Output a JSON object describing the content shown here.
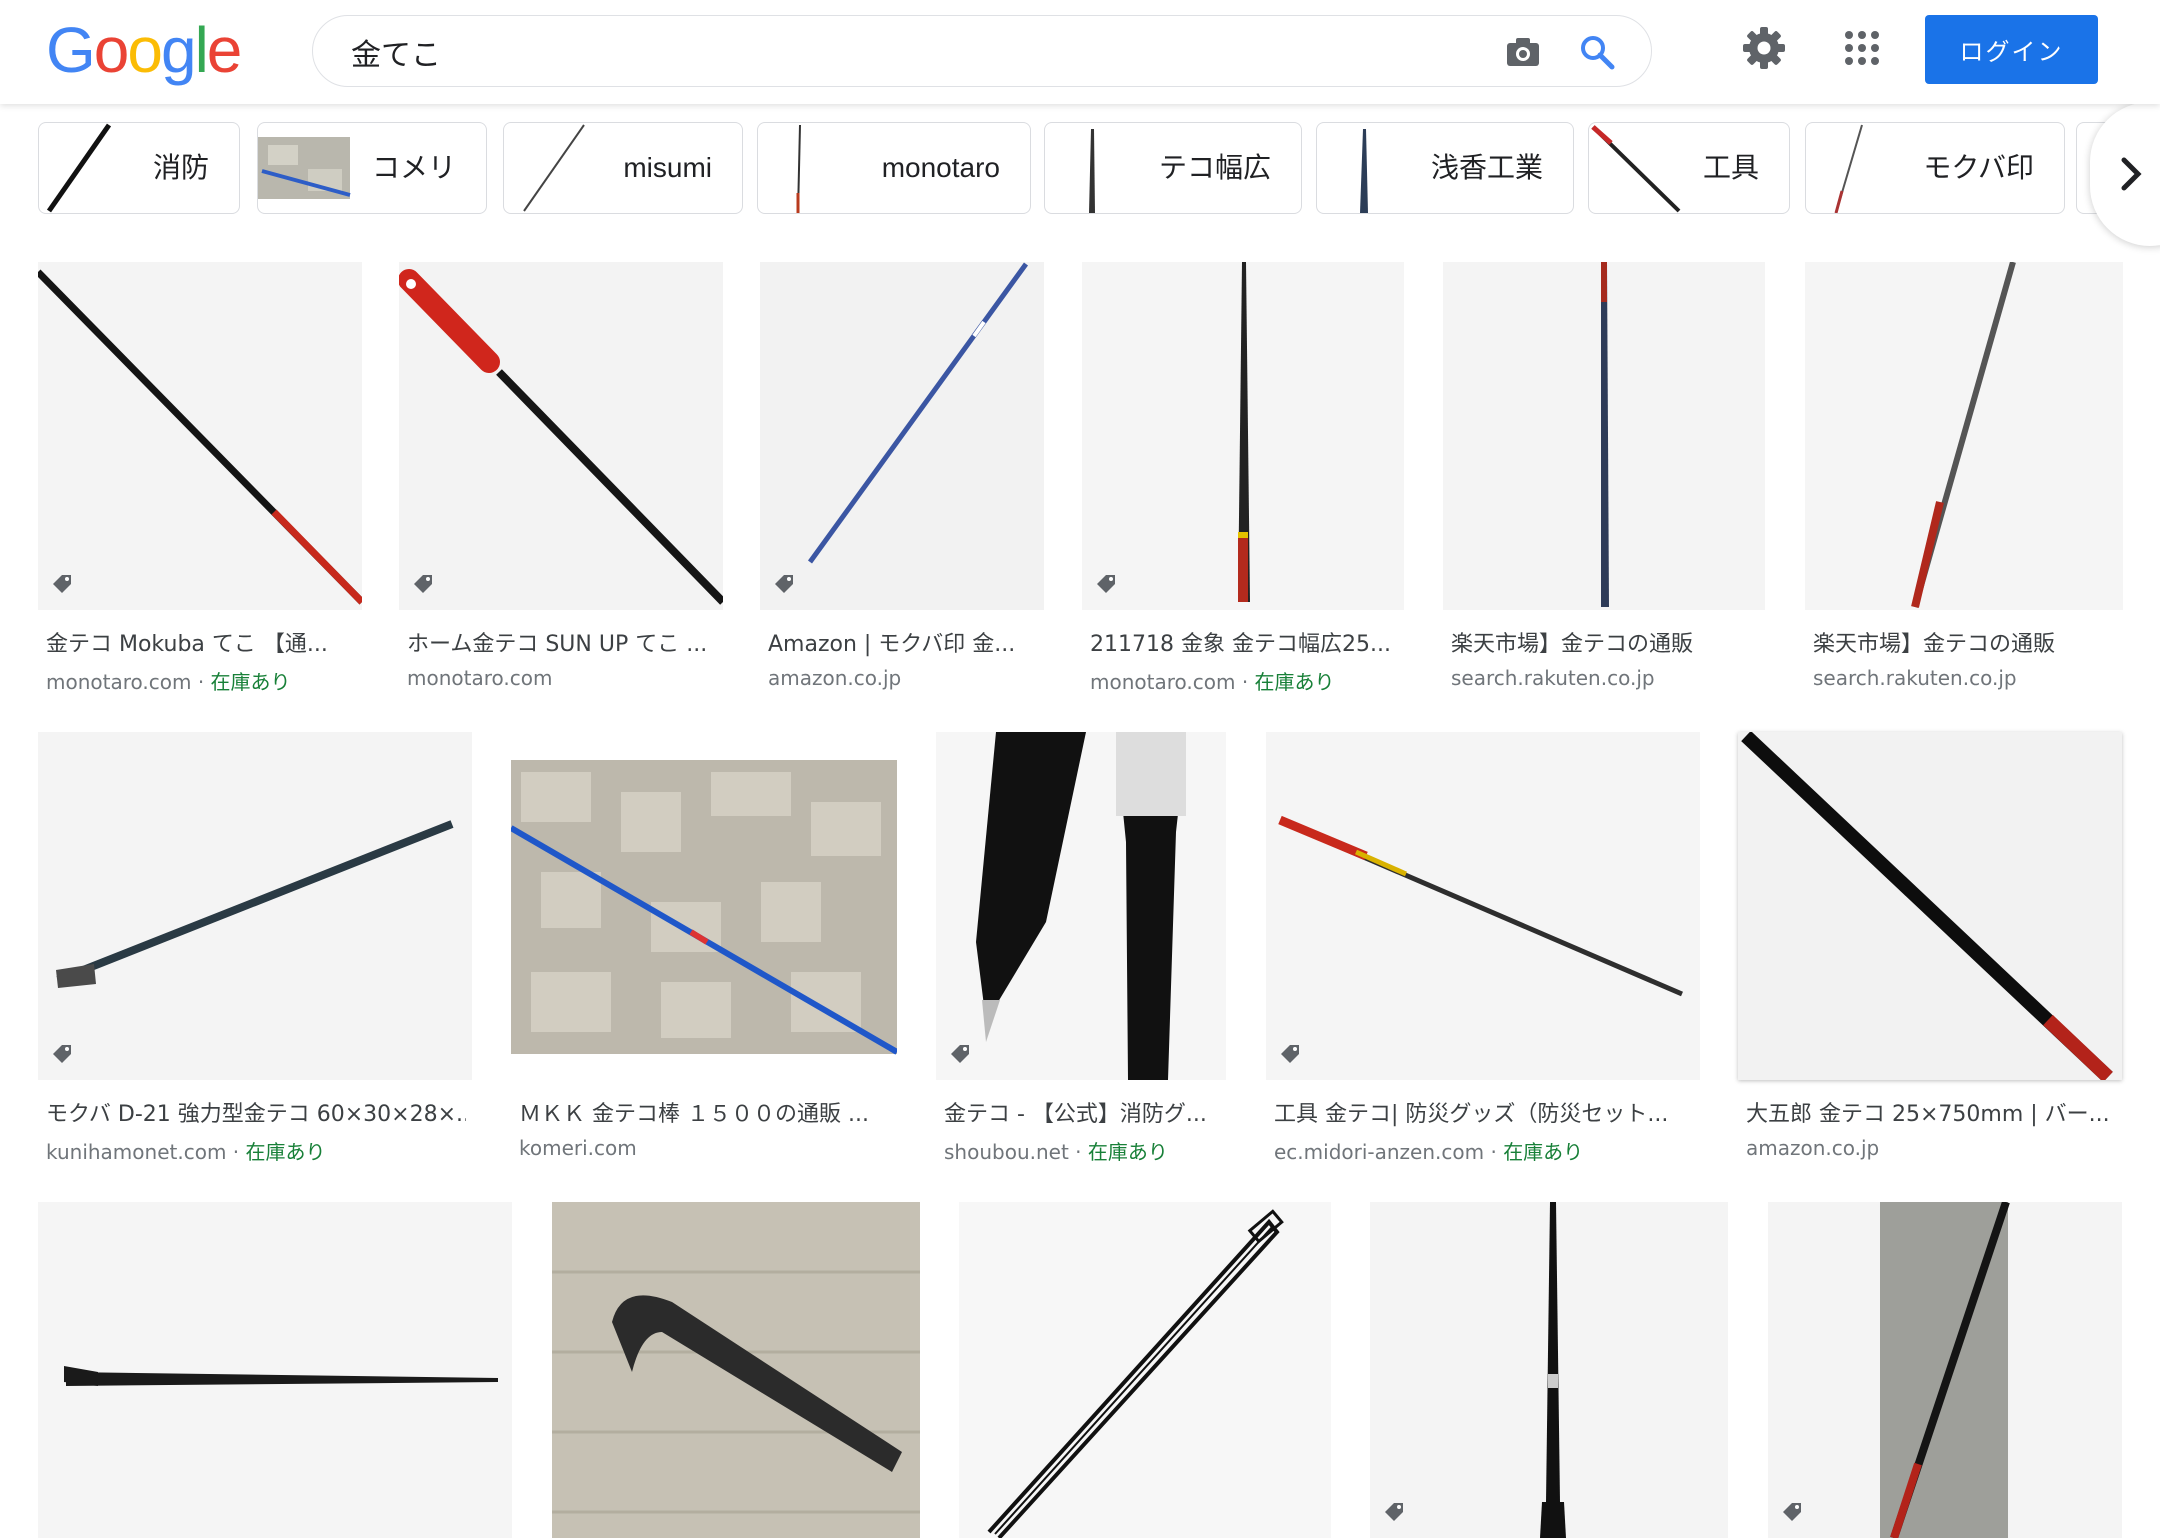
{
  "brand": {
    "logo_letters": [
      "G",
      "o",
      "o",
      "g",
      "l",
      "e"
    ],
    "logo_colors": [
      "#4285F4",
      "#EA4335",
      "#FBBC05",
      "#4285F4",
      "#34A853",
      "#EA4335"
    ],
    "accent": "#1a73e8",
    "stock_color": "#188038"
  },
  "search": {
    "query": "金てこ"
  },
  "header": {
    "login_label": "ログイン",
    "icons": [
      "camera-icon",
      "search-icon",
      "gear-icon",
      "apps-grid-icon"
    ]
  },
  "chips": [
    {
      "label": "消防"
    },
    {
      "label": "コメリ"
    },
    {
      "label": "misumi"
    },
    {
      "label": "monotaro"
    },
    {
      "label": "テコ幅広"
    },
    {
      "label": "浅香工業"
    },
    {
      "label": "工具"
    },
    {
      "label": "モクバ印"
    }
  ],
  "results": [
    {
      "title": "金テコ Mokuba てこ 【通...",
      "source": "monotaro.com",
      "stock": "在庫あり"
    },
    {
      "title": "ホーム金テコ SUN UP てこ ...",
      "source": "monotaro.com",
      "stock": ""
    },
    {
      "title": "Amazon | モクバ印 金...",
      "source": "amazon.co.jp",
      "stock": ""
    },
    {
      "title": "211718 金象 金テコ幅広25...",
      "source": "monotaro.com",
      "stock": "在庫あり"
    },
    {
      "title": "楽天市場】金テコの通販",
      "source": "search.rakuten.co.jp",
      "stock": ""
    },
    {
      "title": "楽天市場】金テコの通販",
      "source": "search.rakuten.co.jp",
      "stock": ""
    },
    {
      "title": "モクバ D-21 強力型金テコ 60×30×28×...",
      "source": "kunihamonet.com",
      "stock": "在庫あり"
    },
    {
      "title": "ＭＫＫ 金テコ棒 １５００の通販 ...",
      "source": "komeri.com",
      "stock": ""
    },
    {
      "title": "金テコ - 【公式】消防グ...",
      "source": "shoubou.net",
      "stock": "在庫あり"
    },
    {
      "title": "工具 金テコ| 防災グッズ（防災セット...",
      "source": "ec.midori-anzen.com",
      "stock": "在庫あり"
    },
    {
      "title": "大五郎 金テコ 25×750mm | バー...",
      "source": "amazon.co.jp",
      "stock": ""
    },
    {
      "title": "",
      "source": "",
      "stock": ""
    },
    {
      "title": "",
      "source": "",
      "stock": ""
    },
    {
      "title": "",
      "source": "",
      "stock": ""
    },
    {
      "title": "",
      "source": "",
      "stock": ""
    },
    {
      "title": "",
      "source": "",
      "stock": ""
    }
  ]
}
